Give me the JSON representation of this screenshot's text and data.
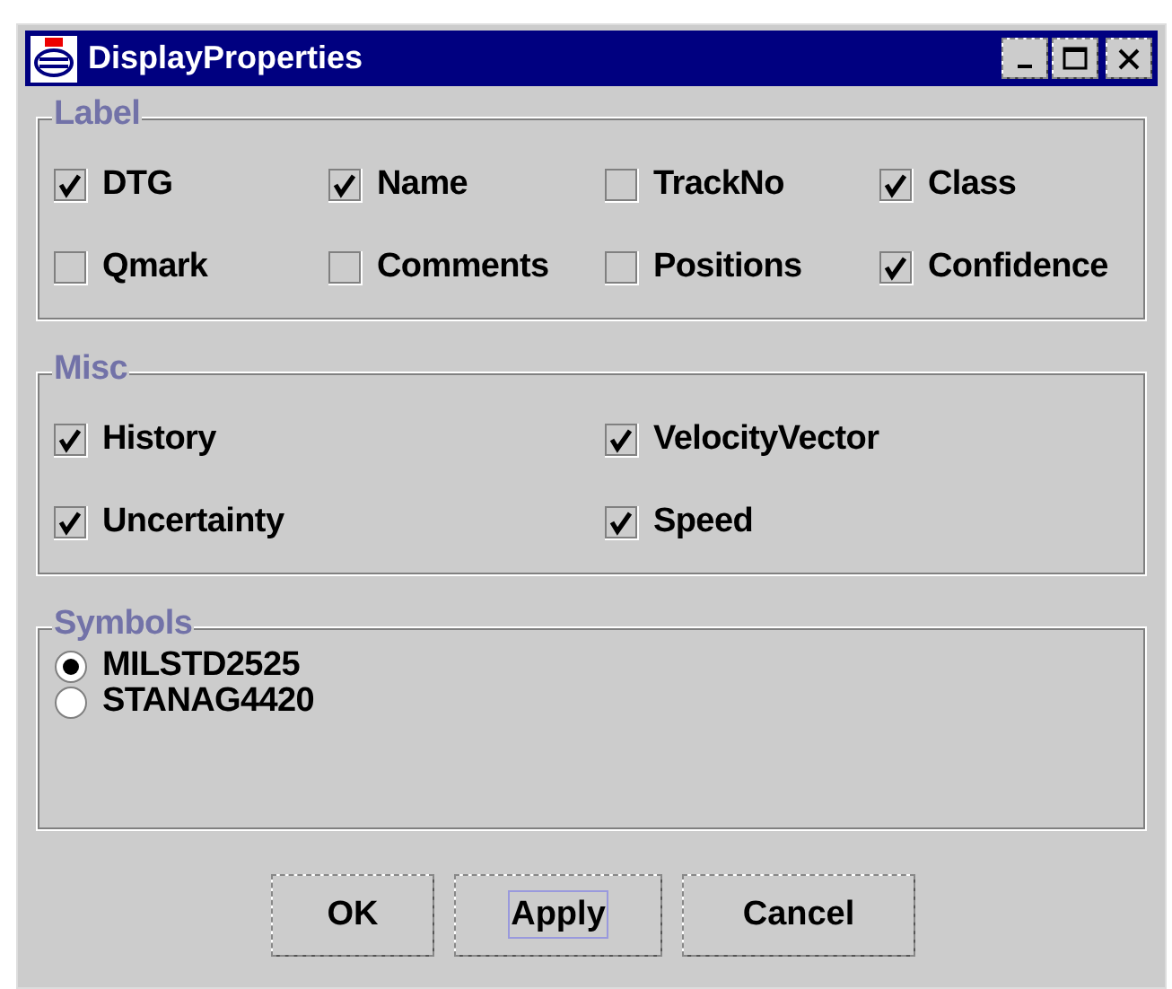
{
  "window": {
    "title": "DisplayProperties"
  },
  "groups": [
    {
      "title": "Label",
      "kind": "checkboxes",
      "items": [
        {
          "label": "DTG",
          "checked": true
        },
        {
          "label": "Name",
          "checked": true
        },
        {
          "label": "TrackNo",
          "checked": false
        },
        {
          "label": "Class",
          "checked": true
        },
        {
          "label": "Qmark",
          "checked": false
        },
        {
          "label": "Comments",
          "checked": false
        },
        {
          "label": "Positions",
          "checked": false
        },
        {
          "label": "Confidence",
          "checked": true
        }
      ]
    },
    {
      "title": "Misc",
      "kind": "checkboxes",
      "items": [
        {
          "label": "History",
          "checked": true
        },
        {
          "label": "VelocityVector",
          "checked": true
        },
        {
          "label": "Uncertainty",
          "checked": true
        },
        {
          "label": "Speed",
          "checked": true
        }
      ]
    },
    {
      "title": "Symbols",
      "kind": "radios",
      "items": [
        {
          "label": "MILSTD2525",
          "selected": true
        },
        {
          "label": "STANAG4420",
          "selected": false
        }
      ]
    }
  ],
  "buttons": [
    {
      "label": "OK",
      "focused": false
    },
    {
      "label": "Apply",
      "focused": true
    },
    {
      "label": "Cancel",
      "focused": false
    }
  ]
}
